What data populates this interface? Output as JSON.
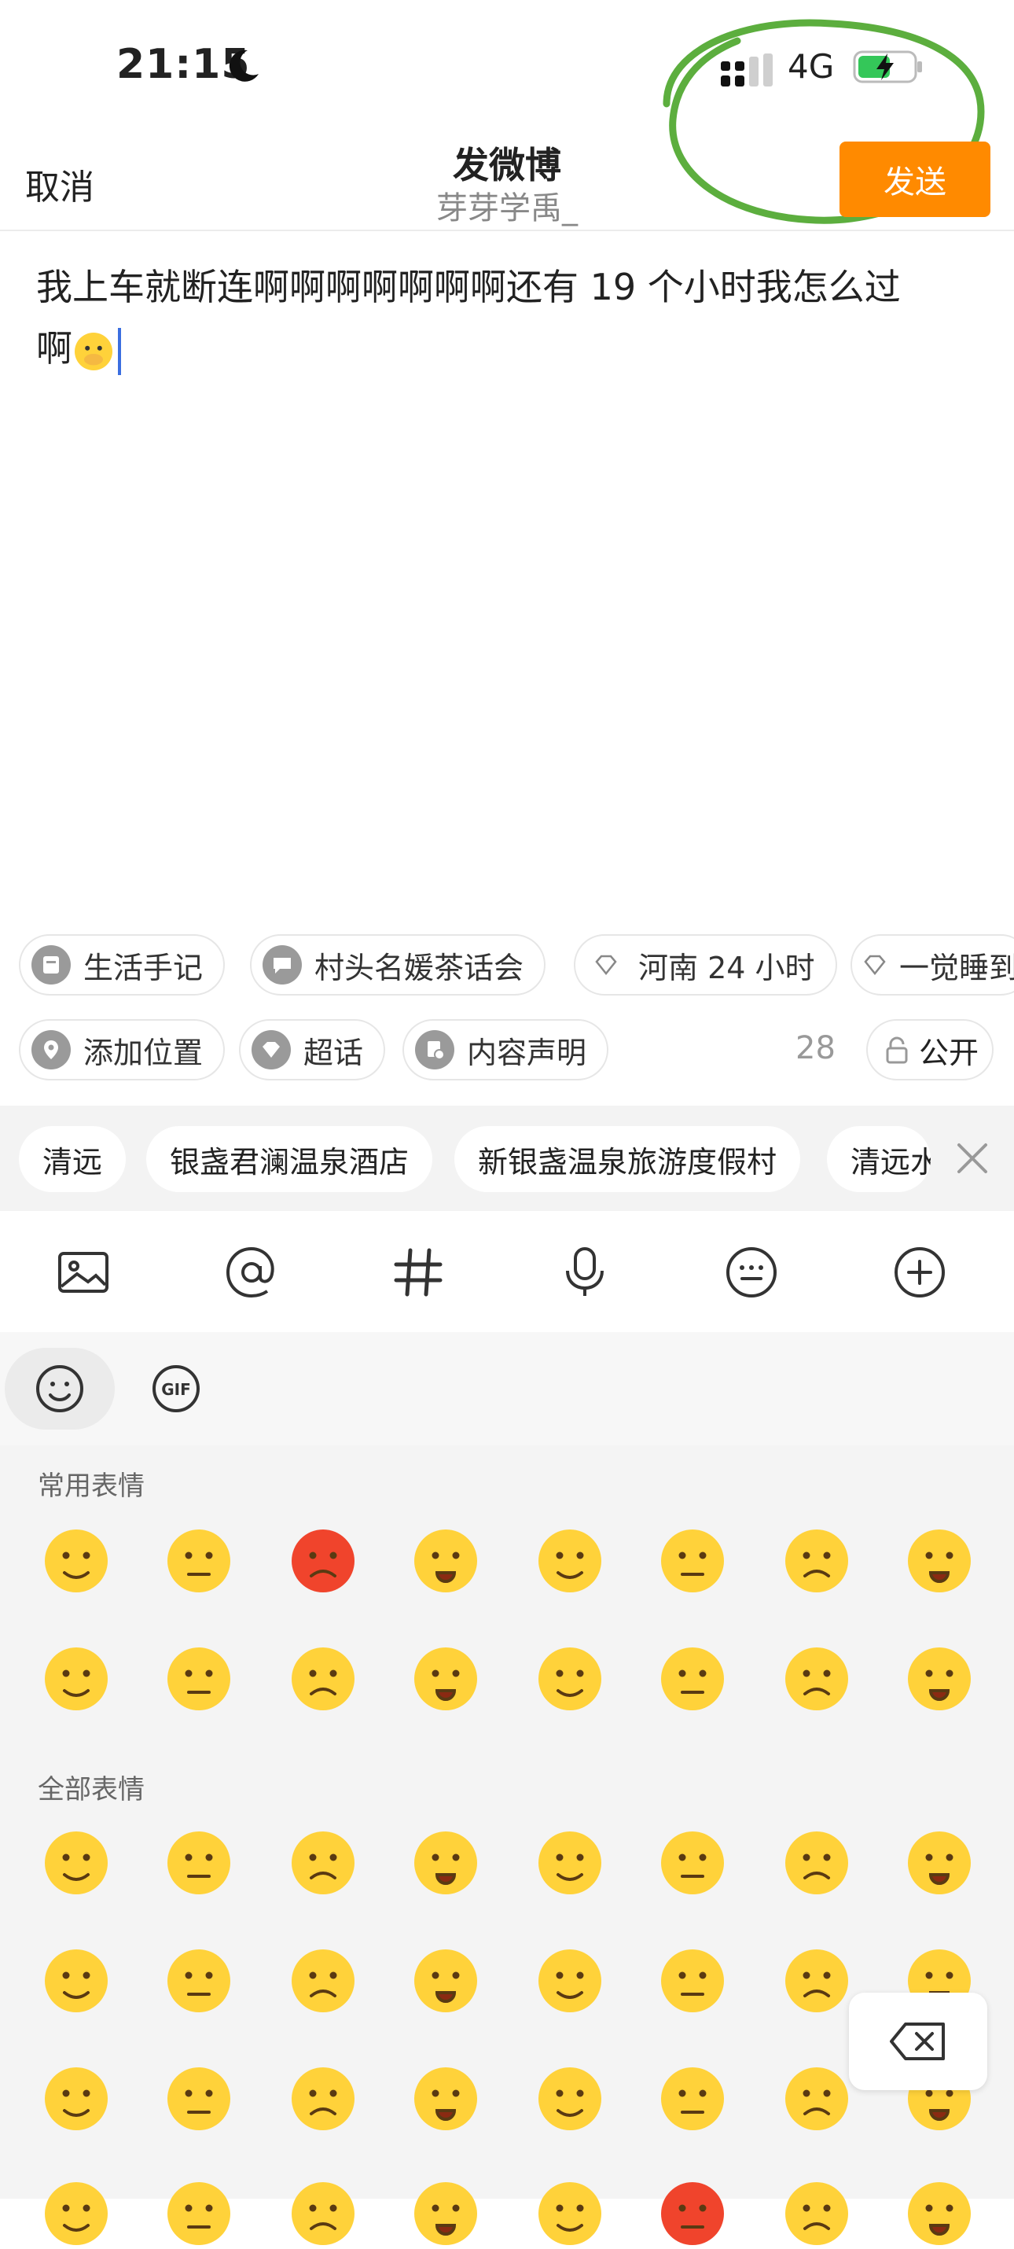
{
  "status_bar": {
    "time": "21:15",
    "network": "4G"
  },
  "header": {
    "cancel_label": "取消",
    "title": "发微博",
    "subtitle": "芽芽学禹_",
    "send_label": "发送"
  },
  "compose": {
    "text_line1": "我上车就断连啊啊啊啊啊啊啊还有 19 个小时我怎么过",
    "text_line2": "啊"
  },
  "topics": [
    {
      "label": "生活手记",
      "icon": "note-icon"
    },
    {
      "label": "村头名媛茶话会",
      "icon": "chat-icon"
    },
    {
      "label": "河南 24 小时",
      "icon": "diamond-icon"
    },
    {
      "label": "一觉睡到",
      "icon": "diamond-icon"
    }
  ],
  "options": {
    "location_label": "添加位置",
    "supertopic_label": "超话",
    "declaration_label": "内容声明",
    "char_count": "28",
    "visibility_label": "公开"
  },
  "location_suggestions": [
    "清远",
    "银盏君澜温泉酒店",
    "新银盏温泉旅游度假村",
    "清远水"
  ],
  "toolbar_icons": [
    "image-icon",
    "at-icon",
    "hashtag-icon",
    "microphone-icon",
    "keyboard-icon",
    "plus-icon"
  ],
  "emoji_panel": {
    "recent_title": "常用表情",
    "all_title": "全部表情"
  },
  "colors": {
    "accent": "#ff8a00",
    "emoji_yellow": "#ffd23a",
    "annotation": "#5cae3e"
  }
}
